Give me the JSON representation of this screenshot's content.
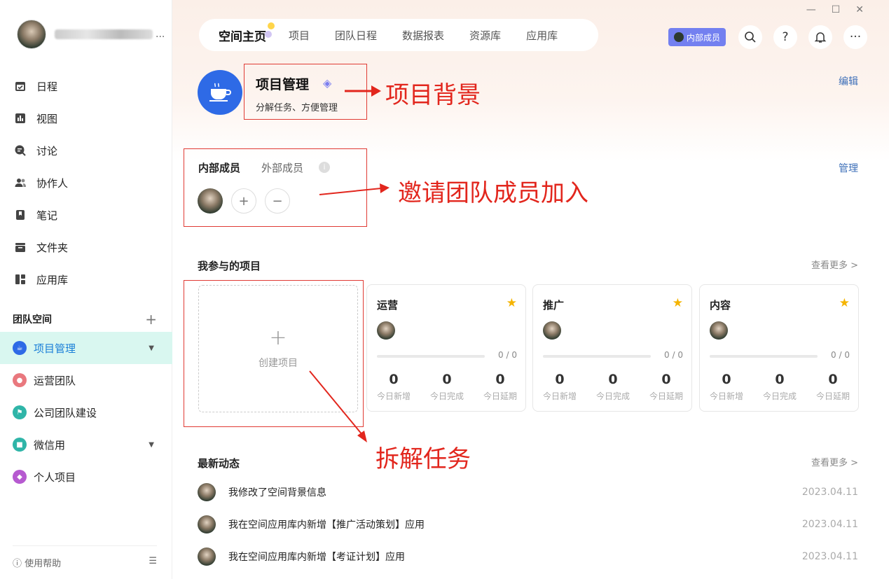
{
  "user": {
    "name_ellipsis": "..."
  },
  "sidebar": {
    "items": [
      {
        "label": "日程",
        "icon": "calendar-icon"
      },
      {
        "label": "视图",
        "icon": "chart-icon"
      },
      {
        "label": "讨论",
        "icon": "chat-icon"
      },
      {
        "label": "协作人",
        "icon": "people-icon"
      },
      {
        "label": "笔记",
        "icon": "note-icon"
      },
      {
        "label": "文件夹",
        "icon": "folder-icon"
      },
      {
        "label": "应用库",
        "icon": "apps-icon"
      }
    ],
    "team_header": "团队空间",
    "teams": [
      {
        "label": "项目管理",
        "color": "#2e6ae6"
      },
      {
        "label": "运营团队",
        "color": "#e9787e"
      },
      {
        "label": "公司团队建设",
        "color": "#2fb5a8"
      },
      {
        "label": "微信用",
        "color": "#2fb5a8"
      },
      {
        "label": "个人项目",
        "color": "#b65ad0"
      }
    ],
    "help": "使用帮助"
  },
  "tabs": [
    "空间主页",
    "项目",
    "团队日程",
    "数据报表",
    "资源库",
    "应用库"
  ],
  "badge": "内部成员",
  "project": {
    "title": "项目管理",
    "subtitle": "分解任务、方便管理",
    "edit": "编辑"
  },
  "annotations": {
    "bg": "项目背景",
    "invite": "邀请团队成员加入",
    "split": "拆解任务"
  },
  "members": {
    "tab_internal": "内部成员",
    "tab_external": "外部成员",
    "info": "i",
    "manage": "管理"
  },
  "projects_section": {
    "title": "我参与的项目",
    "more": "查看更多 >",
    "create": "创建项目",
    "cards": [
      {
        "name": "运营",
        "fraction": "0 / 0",
        "new": "0",
        "done": "0",
        "delayed": "0"
      },
      {
        "name": "推广",
        "fraction": "0 / 0",
        "new": "0",
        "done": "0",
        "delayed": "0"
      },
      {
        "name": "内容",
        "fraction": "0 / 0",
        "new": "0",
        "done": "0",
        "delayed": "0"
      }
    ],
    "stat_labels": {
      "new": "今日新增",
      "done": "今日完成",
      "delayed": "今日延期"
    }
  },
  "feed": {
    "title": "最新动态",
    "more": "查看更多 >",
    "items": [
      {
        "text": "我修改了空间背景信息",
        "date": "2023.04.11"
      },
      {
        "text": "我在空间应用库内新增【推广活动策划】应用",
        "date": "2023.04.11"
      },
      {
        "text": "我在空间应用库内新增【考证计划】应用",
        "date": "2023.04.11"
      }
    ]
  }
}
